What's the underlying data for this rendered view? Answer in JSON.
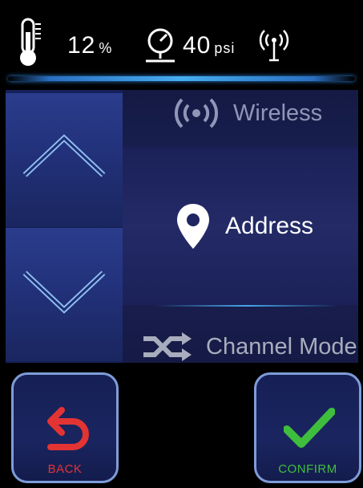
{
  "status": {
    "humidity_value": "12",
    "humidity_unit": "%",
    "pressure_value": "40",
    "pressure_unit": "psi",
    "icons": [
      "thermometer-icon",
      "pressure-gauge-icon",
      "wireless-signal-icon"
    ]
  },
  "menu": {
    "items": [
      {
        "label": "Wireless",
        "icon": "wireless-icon",
        "state": "partial"
      },
      {
        "label": "Address",
        "icon": "location-pin-icon",
        "state": "selected"
      },
      {
        "label": "Channel Mode",
        "icon": "shuffle-icon",
        "state": "partial"
      }
    ],
    "scroll_icons": [
      "chevron-up-icon",
      "chevron-down-icon"
    ]
  },
  "actions": {
    "back_label": "BACK",
    "confirm_label": "CONFIRM"
  },
  "colors": {
    "back_accent": "#e33434",
    "confirm_accent": "#3fbe3d",
    "glow_accent": "#46aef0"
  }
}
